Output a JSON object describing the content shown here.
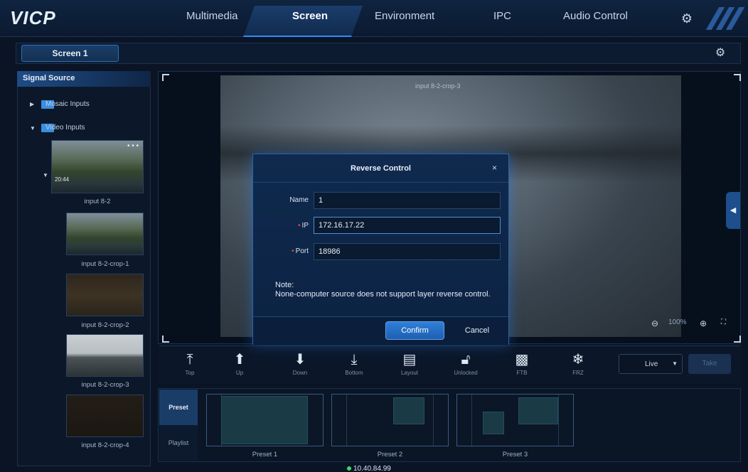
{
  "app": {
    "logo": "VICP"
  },
  "nav": {
    "items": [
      {
        "label": "Multimedia"
      },
      {
        "label": "Screen"
      },
      {
        "label": "Environment"
      },
      {
        "label": "IPC"
      },
      {
        "label": "Audio Control"
      }
    ],
    "active": "Screen"
  },
  "screen_tab": {
    "label": "Screen 1"
  },
  "signal_source": {
    "title": "Signal Source",
    "folders": [
      {
        "label": "Mosaic Inputs",
        "expanded": false
      },
      {
        "label": "Video Inputs",
        "expanded": true
      }
    ],
    "inputs": [
      {
        "label": "input 8-2",
        "thumb_time": "20:44"
      },
      {
        "label": "input 8-2-crop-1"
      },
      {
        "label": "input 8-2-crop-2"
      },
      {
        "label": "input 8-2-crop-3"
      },
      {
        "label": "input 8-2-crop-4"
      }
    ]
  },
  "preview": {
    "layer_label": "input 8-2-crop-3",
    "zoom": "100%"
  },
  "toolbar": {
    "tools": [
      {
        "label": "Top",
        "icon": "arrow-top-icon"
      },
      {
        "label": "Up",
        "icon": "arrow-up-icon"
      },
      {
        "label": "Down",
        "icon": "arrow-down-icon"
      },
      {
        "label": "Bottom",
        "icon": "arrow-bottom-icon"
      },
      {
        "label": "Layout",
        "icon": "layout-icon"
      },
      {
        "label": "Unlocked",
        "icon": "unlock-icon"
      },
      {
        "label": "FTB",
        "icon": "ftb-icon"
      },
      {
        "label": "FRZ",
        "icon": "snowflake-icon"
      }
    ],
    "mode_value": "Live",
    "take_label": "Take"
  },
  "preset_panel": {
    "tabs": [
      {
        "label": "Preset",
        "active": true
      },
      {
        "label": "Playlist",
        "active": false
      }
    ],
    "presets": [
      {
        "label": "Preset 1"
      },
      {
        "label": "Preset 2"
      },
      {
        "label": "Preset 3"
      }
    ]
  },
  "status": {
    "ip": "10.40.84.99"
  },
  "dialog": {
    "title": "Reverse Control",
    "close_icon": "×",
    "fields": {
      "name": {
        "label": "Name",
        "value": "1",
        "required": false
      },
      "ip": {
        "label": "IP",
        "value": "172.16.17.22",
        "required": true
      },
      "port": {
        "label": "Port",
        "value": "18986",
        "required": true
      }
    },
    "note_title": "Note:",
    "note_text": "None-computer source does not support layer reverse control.",
    "confirm_label": "Confirm",
    "cancel_label": "Cancel"
  },
  "colors": {
    "accent": "#2d8cff",
    "required_marker": "#e04848",
    "status_online": "#3fd76b"
  }
}
